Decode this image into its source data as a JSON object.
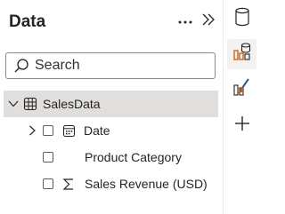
{
  "pane": {
    "title": "Data",
    "more_icon": "ellipsis-icon",
    "collapse_icon": "double-chevron-right-icon"
  },
  "search": {
    "placeholder": "Search",
    "value": ""
  },
  "tree": {
    "table": {
      "label": "SalesData",
      "icon": "table-icon",
      "expanded": true
    },
    "fields": [
      {
        "label": "Date",
        "icon": "calendar-icon",
        "expandable": true,
        "checked": false
      },
      {
        "label": "Product Category",
        "icon": "",
        "expandable": false,
        "checked": false
      },
      {
        "label": "Sales Revenue (USD)",
        "icon": "sigma-icon",
        "expandable": false,
        "checked": false
      }
    ]
  },
  "rail": {
    "items": [
      {
        "icon": "cylinder-icon",
        "active": false
      },
      {
        "icon": "data-model-icon",
        "active": true
      },
      {
        "icon": "format-brush-icon",
        "active": false
      },
      {
        "icon": "plus-icon",
        "active": false
      }
    ]
  },
  "colors": {
    "accent": "#c55a11",
    "selected_row": "#e1dfdd",
    "text": "#252423"
  }
}
